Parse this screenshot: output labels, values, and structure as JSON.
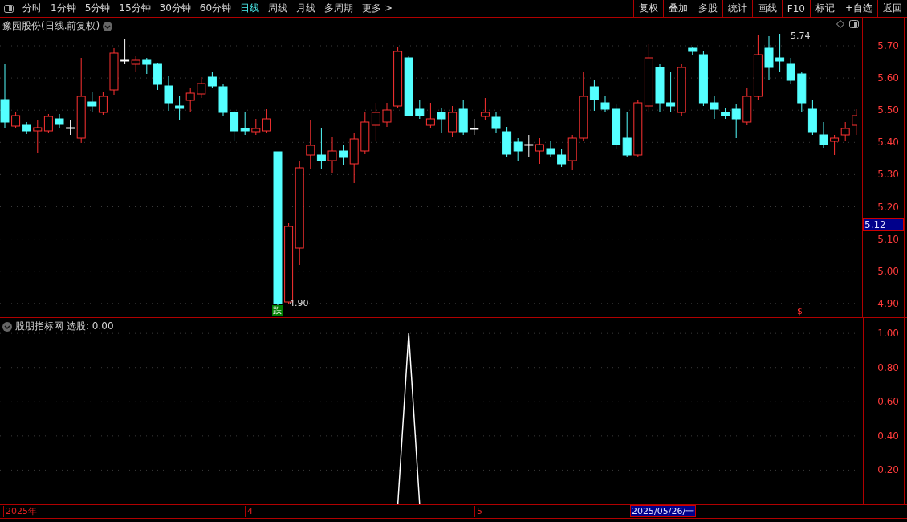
{
  "toolbar": {
    "tabs": [
      {
        "label": "分时",
        "selected": false
      },
      {
        "label": "1分钟",
        "selected": false
      },
      {
        "label": "5分钟",
        "selected": false
      },
      {
        "label": "15分钟",
        "selected": false
      },
      {
        "label": "30分钟",
        "selected": false
      },
      {
        "label": "60分钟",
        "selected": false
      },
      {
        "label": "日线",
        "selected": true
      },
      {
        "label": "周线",
        "selected": false
      },
      {
        "label": "月线",
        "selected": false
      },
      {
        "label": "多周期",
        "selected": false
      },
      {
        "label": "更多 >",
        "selected": false
      }
    ],
    "buttons": [
      "复权",
      "叠加",
      "多股",
      "统计",
      "画线",
      "F10",
      "标记",
      "+自选",
      "返回"
    ]
  },
  "price_chart": {
    "title": "豫园股份(日线.前复权)",
    "high_label": "5.74",
    "low_label": "4.90",
    "fall_badge": "跌",
    "signal_mark": "$",
    "axis_ticks": [
      "5.70",
      "5.60",
      "5.50",
      "5.40",
      "5.30",
      "5.20",
      "5.10",
      "5.00",
      "4.90"
    ],
    "current_price": "5.12"
  },
  "indicator": {
    "name": "股朋指标网",
    "reading": "选股: 0.00",
    "chart_data": {
      "type": "line",
      "series": [
        {
          "color": "#ffffff",
          "values": [
            0,
            0,
            0,
            0,
            0,
            0,
            0,
            0,
            0,
            0,
            0,
            0,
            0,
            0,
            0,
            0,
            0,
            0,
            0,
            0,
            0,
            0,
            0,
            0,
            0,
            0,
            0,
            0,
            0,
            0,
            0,
            0,
            0,
            0,
            0,
            0,
            0,
            1,
            0,
            0,
            0,
            0,
            0,
            0,
            0,
            0,
            0,
            0,
            0,
            0,
            0,
            0,
            0,
            0,
            0,
            0,
            0,
            0,
            0,
            0,
            0,
            0,
            0,
            0,
            0,
            0,
            0,
            0,
            0,
            0,
            0,
            0,
            0,
            0,
            0,
            0,
            0,
            0,
            0
          ]
        }
      ],
      "ylim": [
        0,
        1.09
      ],
      "grid": true,
      "yticks": [
        {
          "value": 0.2,
          "label": "0.20"
        },
        {
          "value": 0.4,
          "label": "0.40"
        },
        {
          "value": 0.6,
          "label": "0.60"
        },
        {
          "value": 0.8,
          "label": "0.80"
        },
        {
          "value": 1,
          "label": "1.00"
        }
      ]
    }
  },
  "date_axis": {
    "labels": [
      "2025年",
      "4",
      "5"
    ],
    "cursor_date": "2025/05/26/一"
  }
}
